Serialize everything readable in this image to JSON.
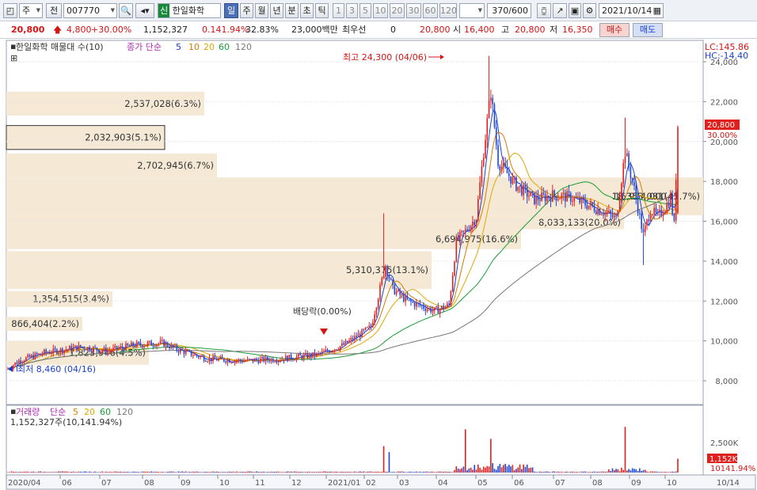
{
  "toolbar": {
    "market": "주",
    "prev_label": "전",
    "code": "007770",
    "stock_name": "한일화학",
    "credit_badge": "신",
    "periods": [
      "일",
      "주",
      "월",
      "년",
      "분",
      "초",
      "틱"
    ],
    "active_period": "일",
    "intervals": [
      "1",
      "3",
      "5",
      "10",
      "20",
      "30",
      "60",
      "120"
    ],
    "count": "370",
    "count_total": "/600",
    "date": "2021/10/14"
  },
  "quote": {
    "price": "20,800",
    "change": "4,800",
    "change_pct": "+30.00%",
    "volume": "1,152,327",
    "vol_ratio": "0.141.94%",
    "turnover": "32.83%",
    "amount": "23,000백만",
    "best_bid_label": "최우선",
    "best_bid": "0",
    "best_ask": "20,800",
    "open_label": "시",
    "open": "16,400",
    "high_label": "고",
    "high": "20,800",
    "low_label": "저",
    "low": "16,350",
    "buy_label": "매수",
    "sell_label": "매도"
  },
  "price_panel": {
    "title": "한일화학 매물대 수(10)",
    "ma_label": "종가 단순",
    "ma_periods": [
      {
        "label": "5",
        "color": "#1a3fd0"
      },
      {
        "label": "10",
        "color": "#d57d00"
      },
      {
        "label": "20",
        "color": "#e0a800"
      },
      {
        "label": "60",
        "color": "#1a9a35"
      },
      {
        "label": "120",
        "color": "#777777"
      }
    ],
    "lc": "LC:145.86",
    "hc": "HC:-14.40",
    "current_price_tag": "20,800",
    "current_pct_tag": "30.00%",
    "high_note": "최고 24,300 (04/06)",
    "low_note": "최저 8,460 (04/16)",
    "dividend_note": "배당락(0.00%)",
    "y_ticks": [
      "24,000",
      "22,000",
      "20,000",
      "18,000",
      "16,000",
      "14,000",
      "12,000",
      "10,000",
      "8,000"
    ],
    "volume_profile": [
      {
        "label": "2,537,028(6.3%)",
        "price_low": 21300,
        "price_high": 22500,
        "length": 250
      },
      {
        "label": "2,032,903(5.1%)",
        "price_low": 19600,
        "price_high": 20800,
        "length": 200
      },
      {
        "label": "2,702,945(6.7%)",
        "price_low": 18200,
        "price_high": 19400,
        "length": 266
      },
      {
        "label": "18,353,081(45.7%)",
        "price_low": 16300,
        "price_high": 18200,
        "length": 880,
        "extra_label": "16,954,000"
      },
      {
        "label": "8,033,133(20.0%)",
        "price_low": 15600,
        "price_high": 16300,
        "length": 780
      },
      {
        "label": "6,694,975(16.6%)",
        "price_low": 14600,
        "price_high": 15600,
        "length": 650
      },
      {
        "label": "5,310,375(13.1%)",
        "price_low": 12600,
        "price_high": 14500,
        "length": 537
      },
      {
        "label": "1,354,515(3.4%)",
        "price_low": 11700,
        "price_high": 12500,
        "length": 134
      },
      {
        "label": "866,404(2.2%)",
        "price_low": 10500,
        "price_high": 11200,
        "length": 96
      },
      {
        "label": "1,823,946(4.5%)",
        "price_low": 8800,
        "price_high": 10000,
        "length": 180
      }
    ]
  },
  "volume_panel": {
    "title": "거래량",
    "ma_label": "단순",
    "ma_periods": [
      {
        "label": "5",
        "color": "#d57d00"
      },
      {
        "label": "20",
        "color": "#e0a800"
      },
      {
        "label": "60",
        "color": "#1a9a35"
      },
      {
        "label": "120",
        "color": "#777777"
      }
    ],
    "value_text": "1,152,327주(10,141.94%)",
    "y_tick": "2,500K",
    "current_tag": "1,152K",
    "pct_tag": "10141.94%"
  },
  "x_axis": [
    "2020/04",
    "06",
    "07",
    "08",
    "09",
    "10",
    "11",
    "12",
    "2021/01",
    "02",
    "03",
    "04",
    "05",
    "06",
    "07",
    "08",
    "09",
    "10",
    "10/14"
  ],
  "colors": {
    "up": "#e0201c",
    "down": "#1f47d6",
    "profile": "#f5e9d6"
  }
}
